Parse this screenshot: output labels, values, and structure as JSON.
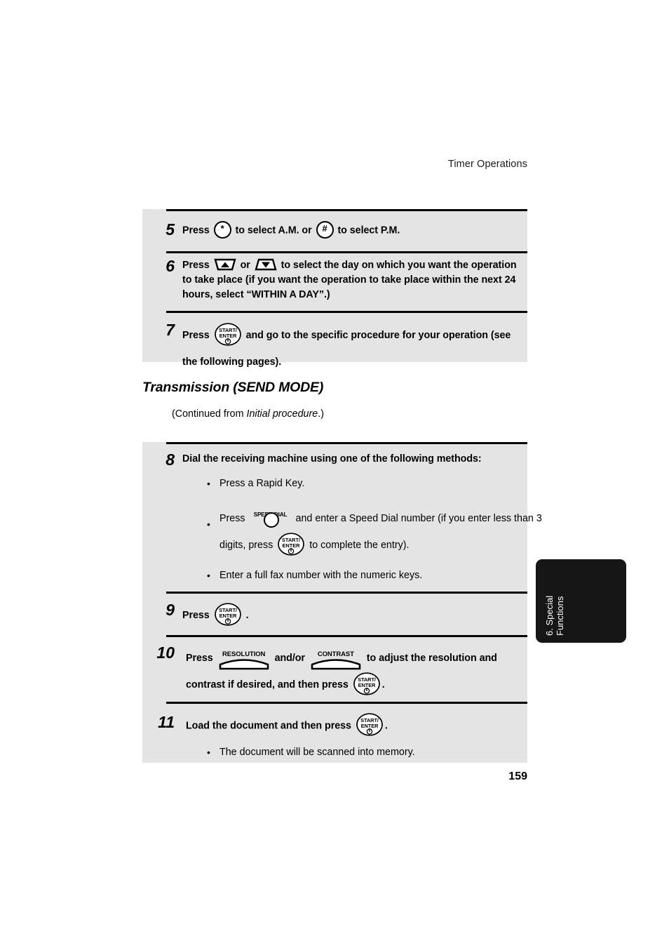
{
  "header": {
    "running_head": "Timer Operations"
  },
  "section": {
    "title": "Transmission (SEND MODE)",
    "continued_prefix": "(Continued from ",
    "continued_italic": "Initial procedure",
    "continued_suffix": ".)"
  },
  "icons": {
    "asterisk": "*",
    "hash": "#",
    "start_top": "START/",
    "start_bottom": "ENTER",
    "speed_dial_label": "SPEED DIAL",
    "resolution_label": "RESOLUTION",
    "contrast_label": "CONTRAST"
  },
  "steps": [
    {
      "number": "5",
      "parts": [
        {
          "type": "text",
          "value": "Press "
        },
        {
          "type": "icon",
          "value": "asterisk-key"
        },
        {
          "type": "text",
          "value": " to select A.M. or "
        },
        {
          "type": "icon",
          "value": "hash-key"
        },
        {
          "type": "text",
          "value": " to select P.M."
        }
      ]
    },
    {
      "number": "6",
      "parts": [
        {
          "type": "text",
          "value": "Press "
        },
        {
          "type": "icon",
          "value": "arrow-up-key"
        },
        {
          "type": "text",
          "value": " or "
        },
        {
          "type": "icon",
          "value": "arrow-down-key"
        },
        {
          "type": "text",
          "value": " to select the day on which you want the operation to take place (if you want the operation to take place within the next 24 hours, select “WITHIN A DAY”.)"
        }
      ]
    },
    {
      "number": "7",
      "parts": [
        {
          "type": "text",
          "value": "Press "
        },
        {
          "type": "icon",
          "value": "start-enter-key"
        },
        {
          "type": "text",
          "value": " and go to the specific procedure for your operation (see the following pages)."
        }
      ]
    },
    {
      "number": "8",
      "parts": [
        {
          "type": "text",
          "value": "Dial the receiving machine using one of the following methods:"
        }
      ],
      "bullets": [
        [
          {
            "type": "text",
            "value": "Press a Rapid Key."
          }
        ],
        [
          {
            "type": "text",
            "value": "Press "
          },
          {
            "type": "icon",
            "value": "speed-dial-key"
          },
          {
            "type": "text",
            "value": " and enter a Speed Dial number (if you enter less than 3 digits, press "
          },
          {
            "type": "icon",
            "value": "start-enter-key"
          },
          {
            "type": "text",
            "value": " to complete the entry)."
          }
        ],
        [
          {
            "type": "text",
            "value": "Enter a full fax number with the numeric keys."
          }
        ]
      ]
    },
    {
      "number": "9",
      "parts": [
        {
          "type": "text",
          "value": "Press "
        },
        {
          "type": "icon",
          "value": "start-enter-key"
        },
        {
          "type": "text",
          "value": " ."
        }
      ]
    },
    {
      "number": "10",
      "parts": [
        {
          "type": "text",
          "value": "Press "
        },
        {
          "type": "icon",
          "value": "resolution-key"
        },
        {
          "type": "text",
          "value": " and/or "
        },
        {
          "type": "icon",
          "value": "contrast-key"
        },
        {
          "type": "text",
          "value": " to adjust the resolution and contrast if desired, and then press "
        },
        {
          "type": "icon",
          "value": "start-enter-key"
        },
        {
          "type": "text",
          "value": "."
        }
      ]
    },
    {
      "number": "11",
      "parts": [
        {
          "type": "text",
          "value": "Load the document and then press "
        },
        {
          "type": "icon",
          "value": "start-enter-key"
        },
        {
          "type": "text",
          "value": "."
        }
      ],
      "bullets": [
        [
          {
            "type": "text",
            "value": "The document will be scanned into memory."
          }
        ]
      ]
    }
  ],
  "step_text": {
    "s5_a": "Press ",
    "s5_b": " to select A.M. or ",
    "s5_c": " to select P.M.",
    "s6_a": "Press ",
    "s6_b": " or ",
    "s6_c": " to select the day on which you want the operation to take place (if you want the operation to take place within the next 24 hours, select “WITHIN A DAY”.)",
    "s7_a": "Press ",
    "s7_b": " and go to the specific procedure for your operation (see the following pages).",
    "s8_title": "Dial the receiving machine using one of the following methods:",
    "s8_b1": "Press a Rapid Key.",
    "s8_b2_a": "Press ",
    "s8_b2_b": " and enter a Speed Dial number (if you enter less than 3 digits, press ",
    "s8_b2_c": " to complete the entry).",
    "s8_b3": "Enter a full fax number with the numeric keys.",
    "s9_a": "Press ",
    "s9_b": " .",
    "s10_a": "Press ",
    "s10_b": " and/or ",
    "s10_c": " to adjust the resolution and contrast if desired, and then press ",
    "s10_d": ".",
    "s11_a": "Load the document and then press ",
    "s11_b": ".",
    "s11_bullet": "The document will be scanned into memory.",
    "num5": "5",
    "num6": "6",
    "num7": "7",
    "num8": "8",
    "num9": "9",
    "num10": "10",
    "num11": "11",
    "bullet_dot": "•"
  },
  "chapter_tab": {
    "line1": "6. Special",
    "line2": "Functions"
  },
  "folio": {
    "page_number": "159"
  },
  "colors": {
    "panel_background": "#e4e4e4",
    "rule": "#000000",
    "tab_background": "#161616",
    "tab_text": "#ffffff",
    "page_background": "#ffffff"
  }
}
